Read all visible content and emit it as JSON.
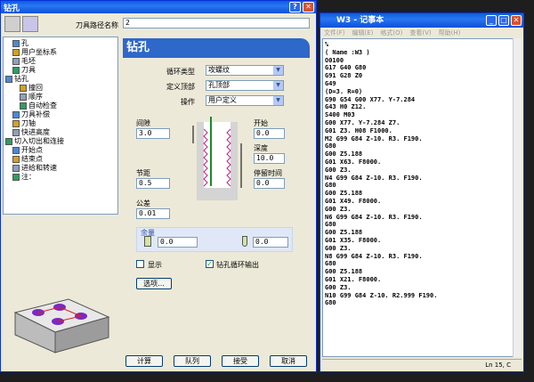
{
  "dialog": {
    "title": "钻孔",
    "help_label": "?",
    "close_label": "✕",
    "tool_path_name_label": "刀具路径名称",
    "tool_path_name_value": "2",
    "banner": "钻孔",
    "tree": [
      {
        "label": "孔",
        "indent": 1
      },
      {
        "label": "用户坐标系",
        "indent": 1
      },
      {
        "label": "毛坯",
        "indent": 1
      },
      {
        "label": "刀具",
        "indent": 1
      },
      {
        "label": "钻孔",
        "indent": 0
      },
      {
        "label": "撞回",
        "indent": 2
      },
      {
        "label": "顺序",
        "indent": 2
      },
      {
        "label": "自动检查",
        "indent": 2
      },
      {
        "label": "刀具补偿",
        "indent": 1
      },
      {
        "label": "刀轴",
        "indent": 1
      },
      {
        "label": "快进高度",
        "indent": 1
      },
      {
        "label": "切入切出和连接",
        "indent": 0
      },
      {
        "label": "开始点",
        "indent": 1
      },
      {
        "label": "结束点",
        "indent": 1
      },
      {
        "label": "进给和转速",
        "indent": 1
      },
      {
        "label": "注：",
        "indent": 1
      }
    ],
    "cycle_type_label": "循环类型",
    "cycle_type_value": "攻螺纹",
    "defined_top_label": "定义顶部",
    "defined_top_value": "孔顶部",
    "operation_label": "操作",
    "operation_value": "用户定义",
    "clearance_label": "间隙",
    "clearance_value": "3.0",
    "start_label": "开始",
    "start_value": "0.0",
    "depth_label": "深度",
    "depth_value": "10.0",
    "pitch_label": "节距",
    "pitch_value": "0.5",
    "dwell_label": "停留时间",
    "dwell_value": "0.0",
    "tolerance_label": "公差",
    "tolerance_value": "0.01",
    "allowance_label": "余量",
    "allowance_left": "0.0",
    "allowance_right": "0.0",
    "show_label": "显示",
    "output_cycle_label": "钻孔循环输出",
    "options_button": "选项...",
    "buttons": [
      "计算",
      "队列",
      "接受",
      "取消"
    ]
  },
  "notepad": {
    "title": "W3 - 记事本",
    "menu": [
      "文件(F)",
      "编辑(E)",
      "格式(O)",
      "查看(V)",
      "帮助(H)"
    ],
    "lines": [
      "%",
      "( Name :W3 )",
      "O0100",
      "G17 G40 G80",
      "G91 G28 Z0",
      "G49",
      "(D=3. R=0)",
      "G90 G54 G00 X77. Y-7.284",
      "G43 H0 Z12.",
      "S400 M03",
      "G00 X77. Y-7.284 Z7.",
      "G01 Z3. H08 F1000.",
      "M2 G99 G84 Z-10. R3. F190.",
      "G80",
      "G00 Z5.188",
      "G01 X63. F8000.",
      "G00 Z3.",
      "N4 G99 G84 Z-10. R3. F190.",
      "G80",
      "G00 Z5.188",
      "G01 X49. F8000.",
      "G00 Z3.",
      "N6 G99 G84 Z-10. R3. F190.",
      "G80",
      "G00 Z5.188",
      "G01 X35. F8000.",
      "G00 Z3.",
      "N8 G99 G84 Z-10. R3. F190.",
      "G80",
      "G00 Z5.188",
      "G01 X21. F8000.",
      "G00 Z3.",
      "N10 G99 G84 Z-10. R2.999 F190.",
      "G80"
    ],
    "status": "Ln 15, C"
  }
}
